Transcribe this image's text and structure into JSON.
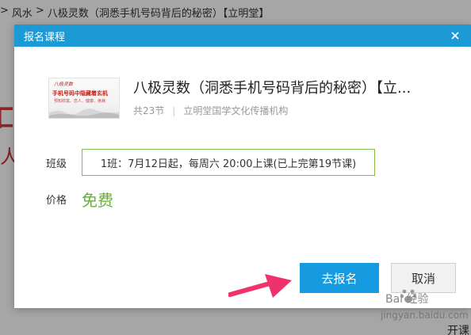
{
  "breadcrumb": {
    "sep1": ">",
    "item1": "风水",
    "sep2": ">",
    "item2": "八极灵数（洞悉手机号码背后的秘密）【立明堂】"
  },
  "background": {
    "bottom_text": "开课"
  },
  "dialog": {
    "title": "报名课程",
    "close_label": "×",
    "header_color": "#1b9ad6"
  },
  "course": {
    "title": "八极灵数（洞悉手机号码背后的秘密）【立...",
    "lessons": "共23节",
    "meta_sep": "|",
    "org": "立明堂国学文化传播机构",
    "thumb_line1": "八极灵数",
    "thumb_line2": "手机号码中隐藏着玄机",
    "thumb_line3": "预知财富、恋人、健康、疾病"
  },
  "class": {
    "label": "班级",
    "option": "1班：7月12日起，每周六 20:00上课(已上完第19节课)"
  },
  "price": {
    "label": "价格",
    "value": "免费",
    "color": "#67b038"
  },
  "buttons": {
    "enroll": "去报名",
    "cancel": "取消"
  },
  "watermark": {
    "brand": "Bai 经验",
    "url": "jingyan.baidu.com"
  }
}
